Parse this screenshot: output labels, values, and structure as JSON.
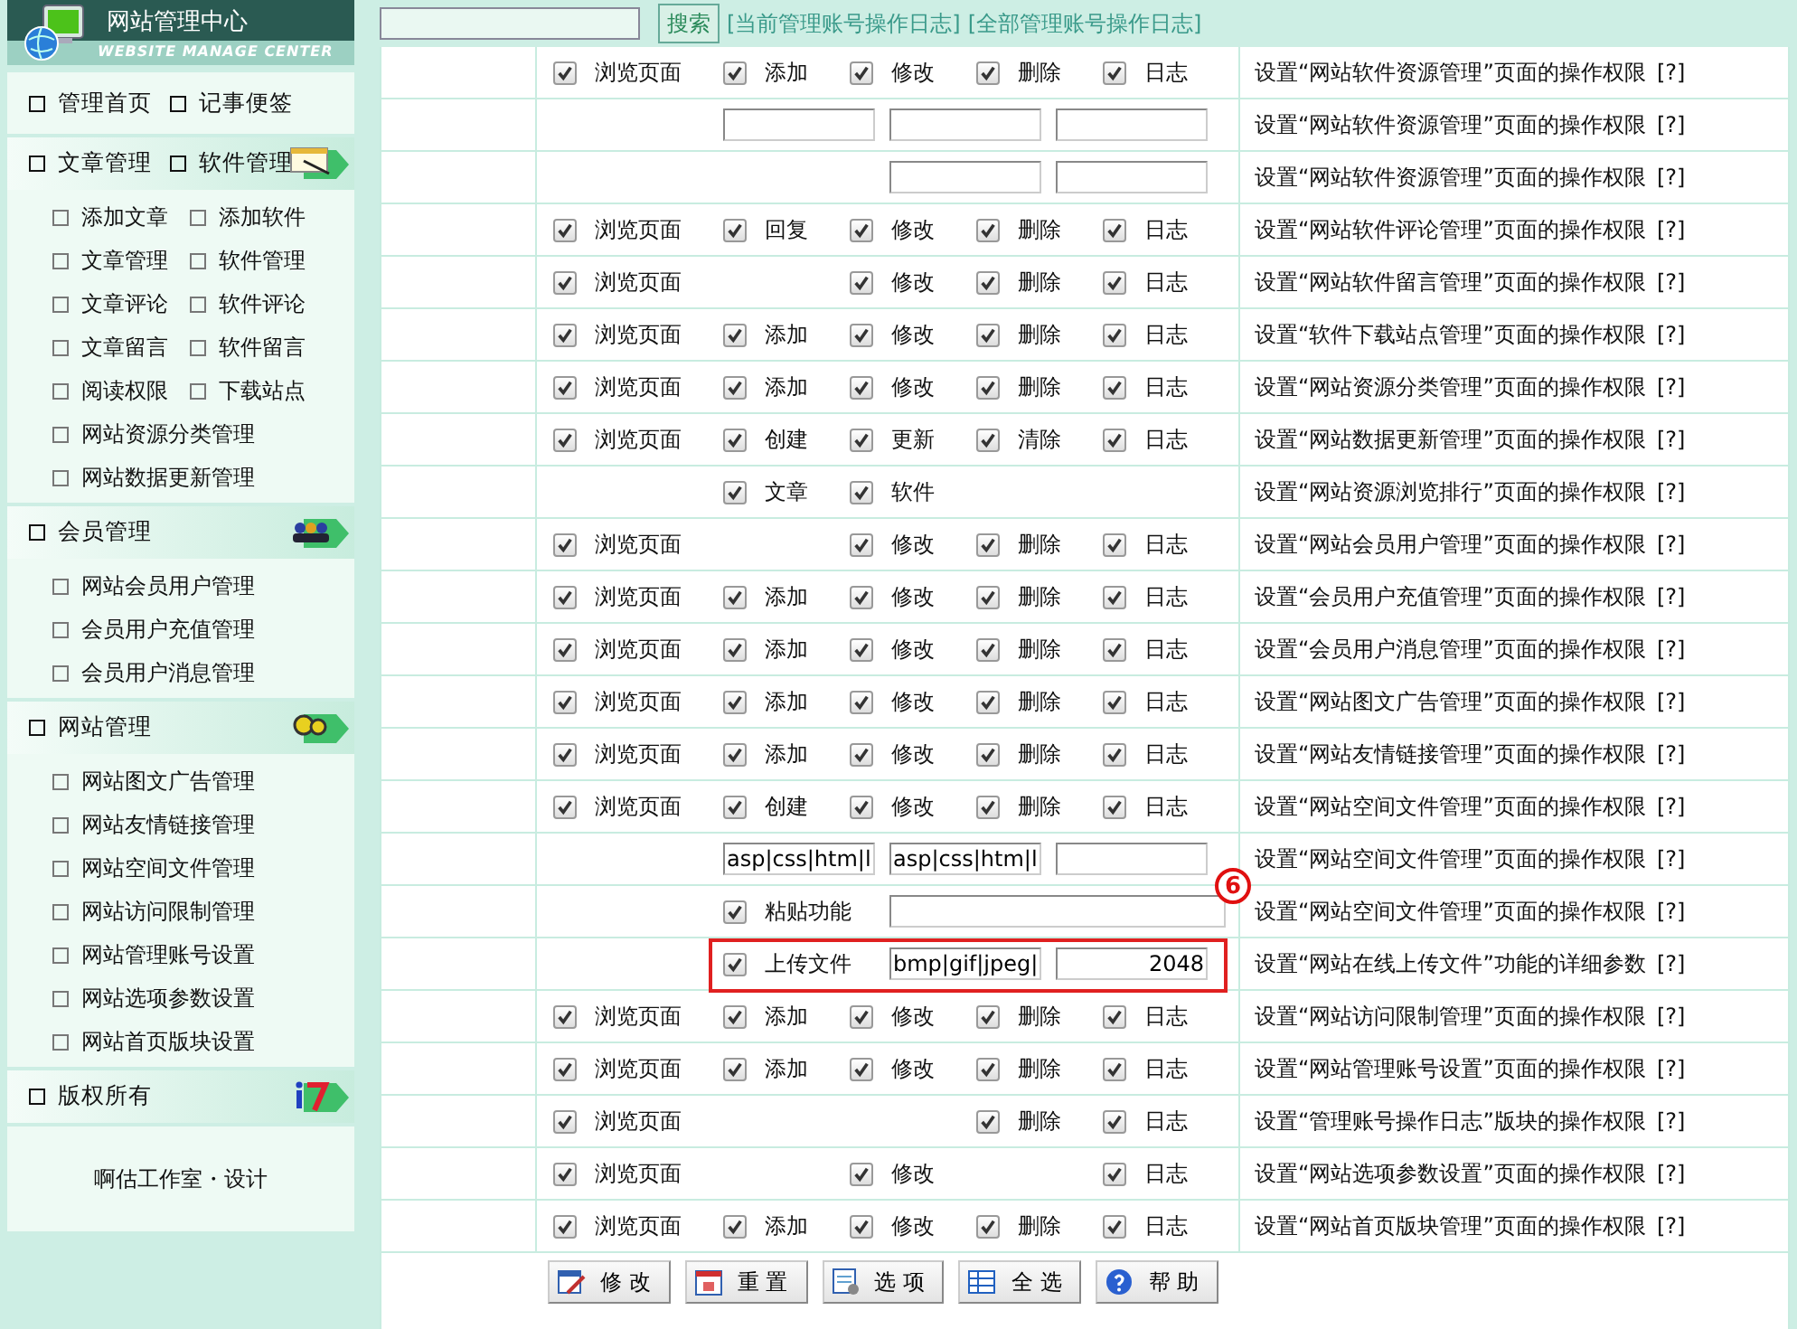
{
  "sidebar": {
    "title": "网站管理中心",
    "subtitle": "WEBSITE MANAGE CENTER",
    "sections": [
      {
        "headers": [
          "管理首页",
          "记事便签"
        ]
      },
      {
        "headers": [
          "文章管理",
          "软件管理"
        ],
        "rows": [
          [
            "添加文章",
            "添加软件"
          ],
          [
            "文章管理",
            "软件管理"
          ],
          [
            "文章评论",
            "软件评论"
          ],
          [
            "文章留言",
            "软件留言"
          ],
          [
            "阅读权限",
            "下载站点"
          ],
          [
            "网站资源分类管理"
          ],
          [
            "网站数据更新管理"
          ]
        ]
      },
      {
        "headers": [
          "会员管理"
        ],
        "rows": [
          [
            "网站会员用户管理"
          ],
          [
            "会员用户充值管理"
          ],
          [
            "会员用户消息管理"
          ]
        ]
      },
      {
        "headers": [
          "网站管理"
        ],
        "rows": [
          [
            "网站图文广告管理"
          ],
          [
            "网站友情链接管理"
          ],
          [
            "网站空间文件管理"
          ],
          [
            "网站访问限制管理"
          ],
          [
            "网站管理账号设置"
          ],
          [
            "网站选项参数设置"
          ],
          [
            "网站首页版块设置"
          ]
        ]
      },
      {
        "headers": [
          "版权所有"
        ]
      }
    ],
    "credit": "啊估工作室・设计"
  },
  "topbar": {
    "search_button": "搜索",
    "links": [
      "[当前管理账号操作日志]",
      "[全部管理账号操作日志]"
    ]
  },
  "rows": [
    {
      "cells": [
        {
          "kind": "checkbox",
          "label": "浏览页面",
          "checked": true
        },
        {
          "kind": "checkbox",
          "label": "添加",
          "checked": true
        },
        {
          "kind": "checkbox",
          "label": "修改",
          "checked": true
        },
        {
          "kind": "checkbox",
          "label": "删除",
          "checked": true
        },
        {
          "kind": "checkbox",
          "label": "日志",
          "checked": true
        }
      ],
      "description": "设置“网站软件资源管理”页面的操作权限",
      "help": "[?]"
    },
    {
      "cells": [
        {
          "kind": "blank"
        },
        {
          "kind": "input"
        },
        {
          "kind": "input"
        },
        {
          "kind": "input"
        }
      ],
      "description": "设置“网站软件资源管理”页面的操作权限",
      "help": "[?]"
    },
    {
      "cells": [
        {
          "kind": "blank"
        },
        {
          "kind": "blank"
        },
        {
          "kind": "input"
        },
        {
          "kind": "input"
        }
      ],
      "description": "设置“网站软件资源管理”页面的操作权限",
      "help": "[?]"
    },
    {
      "cells": [
        {
          "kind": "checkbox",
          "label": "浏览页面",
          "checked": true
        },
        {
          "kind": "checkbox",
          "label": "回复",
          "checked": true
        },
        {
          "kind": "checkbox",
          "label": "修改",
          "checked": true
        },
        {
          "kind": "checkbox",
          "label": "删除",
          "checked": true
        },
        {
          "kind": "checkbox",
          "label": "日志",
          "checked": true
        }
      ],
      "description": "设置“网站软件评论管理”页面的操作权限",
      "help": "[?]"
    },
    {
      "cells": [
        {
          "kind": "checkbox",
          "label": "浏览页面",
          "checked": true
        },
        {
          "kind": "blank"
        },
        {
          "kind": "checkbox",
          "label": "修改",
          "checked": true
        },
        {
          "kind": "checkbox",
          "label": "删除",
          "checked": true
        },
        {
          "kind": "checkbox",
          "label": "日志",
          "checked": true
        }
      ],
      "description": "设置“网站软件留言管理”页面的操作权限",
      "help": "[?]"
    },
    {
      "cells": [
        {
          "kind": "checkbox",
          "label": "浏览页面",
          "checked": true
        },
        {
          "kind": "checkbox",
          "label": "添加",
          "checked": true
        },
        {
          "kind": "checkbox",
          "label": "修改",
          "checked": true
        },
        {
          "kind": "checkbox",
          "label": "删除",
          "checked": true
        },
        {
          "kind": "checkbox",
          "label": "日志",
          "checked": true
        }
      ],
      "description": "设置“软件下载站点管理”页面的操作权限",
      "help": "[?]"
    },
    {
      "cells": [
        {
          "kind": "checkbox",
          "label": "浏览页面",
          "checked": true
        },
        {
          "kind": "checkbox",
          "label": "添加",
          "checked": true
        },
        {
          "kind": "checkbox",
          "label": "修改",
          "checked": true
        },
        {
          "kind": "checkbox",
          "label": "删除",
          "checked": true
        },
        {
          "kind": "checkbox",
          "label": "日志",
          "checked": true
        }
      ],
      "description": "设置“网站资源分类管理”页面的操作权限",
      "help": "[?]"
    },
    {
      "cells": [
        {
          "kind": "checkbox",
          "label": "浏览页面",
          "checked": true
        },
        {
          "kind": "checkbox",
          "label": "创建",
          "checked": true
        },
        {
          "kind": "checkbox",
          "label": "更新",
          "checked": true
        },
        {
          "kind": "checkbox",
          "label": "清除",
          "checked": true
        },
        {
          "kind": "checkbox",
          "label": "日志",
          "checked": true
        }
      ],
      "description": "设置“网站数据更新管理”页面的操作权限",
      "help": "[?]"
    },
    {
      "cells": [
        {
          "kind": "blank"
        },
        {
          "kind": "checkbox",
          "label": "文章",
          "checked": true
        },
        {
          "kind": "checkbox",
          "label": "软件",
          "checked": true
        }
      ],
      "description": "设置“网站资源浏览排行”页面的操作权限",
      "help": "[?]"
    },
    {
      "cells": [
        {
          "kind": "checkbox",
          "label": "浏览页面",
          "checked": true
        },
        {
          "kind": "blank"
        },
        {
          "kind": "checkbox",
          "label": "修改",
          "checked": true
        },
        {
          "kind": "checkbox",
          "label": "删除",
          "checked": true
        },
        {
          "kind": "checkbox",
          "label": "日志",
          "checked": true
        }
      ],
      "description": "设置“网站会员用户管理”页面的操作权限",
      "help": "[?]"
    },
    {
      "cells": [
        {
          "kind": "checkbox",
          "label": "浏览页面",
          "checked": true
        },
        {
          "kind": "checkbox",
          "label": "添加",
          "checked": true
        },
        {
          "kind": "checkbox",
          "label": "修改",
          "checked": true
        },
        {
          "kind": "checkbox",
          "label": "删除",
          "checked": true
        },
        {
          "kind": "checkbox",
          "label": "日志",
          "checked": true
        }
      ],
      "description": "设置“会员用户充值管理”页面的操作权限",
      "help": "[?]"
    },
    {
      "cells": [
        {
          "kind": "checkbox",
          "label": "浏览页面",
          "checked": true
        },
        {
          "kind": "checkbox",
          "label": "添加",
          "checked": true
        },
        {
          "kind": "checkbox",
          "label": "修改",
          "checked": true
        },
        {
          "kind": "checkbox",
          "label": "删除",
          "checked": true
        },
        {
          "kind": "checkbox",
          "label": "日志",
          "checked": true
        }
      ],
      "description": "设置“会员用户消息管理”页面的操作权限",
      "help": "[?]"
    },
    {
      "cells": [
        {
          "kind": "checkbox",
          "label": "浏览页面",
          "checked": true
        },
        {
          "kind": "checkbox",
          "label": "添加",
          "checked": true
        },
        {
          "kind": "checkbox",
          "label": "修改",
          "checked": true
        },
        {
          "kind": "checkbox",
          "label": "删除",
          "checked": true
        },
        {
          "kind": "checkbox",
          "label": "日志",
          "checked": true
        }
      ],
      "description": "设置“网站图文广告管理”页面的操作权限",
      "help": "[?]"
    },
    {
      "cells": [
        {
          "kind": "checkbox",
          "label": "浏览页面",
          "checked": true
        },
        {
          "kind": "checkbox",
          "label": "添加",
          "checked": true
        },
        {
          "kind": "checkbox",
          "label": "修改",
          "checked": true
        },
        {
          "kind": "checkbox",
          "label": "删除",
          "checked": true
        },
        {
          "kind": "checkbox",
          "label": "日志",
          "checked": true
        }
      ],
      "description": "设置“网站友情链接管理”页面的操作权限",
      "help": "[?]"
    },
    {
      "cells": [
        {
          "kind": "checkbox",
          "label": "浏览页面",
          "checked": true
        },
        {
          "kind": "checkbox",
          "label": "创建",
          "checked": true
        },
        {
          "kind": "checkbox",
          "label": "修改",
          "checked": true
        },
        {
          "kind": "checkbox",
          "label": "删除",
          "checked": true
        },
        {
          "kind": "checkbox",
          "label": "日志",
          "checked": true
        }
      ],
      "description": "设置“网站空间文件管理”页面的操作权限",
      "help": "[?]"
    },
    {
      "cells": [
        {
          "kind": "blank"
        },
        {
          "kind": "input",
          "value": "asp|css|htm|l"
        },
        {
          "kind": "input",
          "value": "asp|css|htm|l"
        },
        {
          "kind": "input"
        }
      ],
      "description": "设置“网站空间文件管理”页面的操作权限",
      "help": "[?]"
    },
    {
      "cells": [
        {
          "kind": "blank"
        },
        {
          "kind": "checkbox",
          "label": "粘贴功能",
          "checked": true
        },
        {
          "kind": "wide_input"
        }
      ],
      "description": "设置“网站空间文件管理”页面的操作权限",
      "help": "[?]",
      "callout": "6"
    },
    {
      "cells": [
        {
          "kind": "blank"
        },
        {
          "kind": "checkbox",
          "label": "上传文件",
          "checked": true
        },
        {
          "kind": "input",
          "value": "bmp|gif|jpeg|"
        },
        {
          "kind": "number_input",
          "value": "2048"
        }
      ],
      "description": "设置“网站在线上传文件”功能的详细参数",
      "help": "[?]",
      "highlighted": true
    },
    {
      "cells": [
        {
          "kind": "checkbox",
          "label": "浏览页面",
          "checked": true
        },
        {
          "kind": "checkbox",
          "label": "添加",
          "checked": true
        },
        {
          "kind": "checkbox",
          "label": "修改",
          "checked": true
        },
        {
          "kind": "checkbox",
          "label": "删除",
          "checked": true
        },
        {
          "kind": "checkbox",
          "label": "日志",
          "checked": true
        }
      ],
      "description": "设置“网站访问限制管理”页面的操作权限",
      "help": "[?]"
    },
    {
      "cells": [
        {
          "kind": "checkbox",
          "label": "浏览页面",
          "checked": true
        },
        {
          "kind": "checkbox",
          "label": "添加",
          "checked": true
        },
        {
          "kind": "checkbox",
          "label": "修改",
          "checked": true
        },
        {
          "kind": "checkbox",
          "label": "删除",
          "checked": true
        },
        {
          "kind": "checkbox",
          "label": "日志",
          "checked": true
        }
      ],
      "description": "设置“网站管理账号设置”页面的操作权限",
      "help": "[?]"
    },
    {
      "cells": [
        {
          "kind": "checkbox",
          "label": "浏览页面",
          "checked": true
        },
        {
          "kind": "blank"
        },
        {
          "kind": "blank"
        },
        {
          "kind": "checkbox",
          "label": "删除",
          "checked": true
        },
        {
          "kind": "checkbox",
          "label": "日志",
          "checked": true
        }
      ],
      "description": "设置“管理账号操作日志”版块的操作权限",
      "help": "[?]"
    },
    {
      "cells": [
        {
          "kind": "checkbox",
          "label": "浏览页面",
          "checked": true
        },
        {
          "kind": "blank"
        },
        {
          "kind": "checkbox",
          "label": "修改",
          "checked": true
        },
        {
          "kind": "blank"
        },
        {
          "kind": "checkbox",
          "label": "日志",
          "checked": true
        }
      ],
      "description": "设置“网站选项参数设置”页面的操作权限",
      "help": "[?]"
    },
    {
      "cells": [
        {
          "kind": "checkbox",
          "label": "浏览页面",
          "checked": true
        },
        {
          "kind": "checkbox",
          "label": "添加",
          "checked": true
        },
        {
          "kind": "checkbox",
          "label": "修改",
          "checked": true
        },
        {
          "kind": "checkbox",
          "label": "删除",
          "checked": true
        },
        {
          "kind": "checkbox",
          "label": "日志",
          "checked": true
        }
      ],
      "description": "设置“网站首页版块管理”页面的操作权限",
      "help": "[?]"
    }
  ],
  "buttons": [
    "修 改",
    "重 置",
    "选 项",
    "全 选",
    "帮 助"
  ]
}
